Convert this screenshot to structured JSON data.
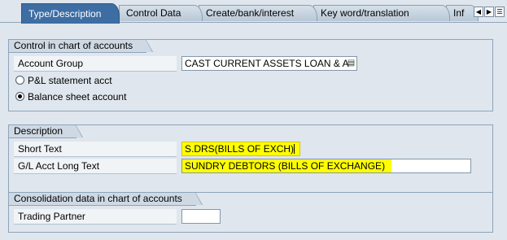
{
  "tabs": [
    {
      "label": "Type/Description",
      "active": true
    },
    {
      "label": "Control Data",
      "active": false
    },
    {
      "label": "Create/bank/interest",
      "active": false
    },
    {
      "label": "Key word/translation",
      "active": false
    },
    {
      "label": "Inf",
      "active": false
    }
  ],
  "tab_nav": {
    "prev_icon": "triangle-left",
    "next_icon": "triangle-right",
    "list_icon": "list"
  },
  "control_group": {
    "title": "Control in chart of accounts",
    "account_group_label": "Account Group",
    "account_group_value": "CAST CURRENT ASSETS LOAN & A",
    "pl_radio_label": "P&L statement acct",
    "bs_radio_label": "Balance sheet account",
    "selected_radio": "Balance sheet account"
  },
  "description_group": {
    "title": "Description",
    "short_text_label": "Short Text",
    "short_text_value": "S.DRS(BILLS OF EXCH)",
    "long_text_label": "G/L Acct Long Text",
    "long_text_value": "SUNDRY DEBTORS (BILLS OF EXCHANGE)"
  },
  "consolidation_group": {
    "title": "Consolidation data in chart of accounts",
    "trading_partner_label": "Trading Partner",
    "trading_partner_value": ""
  },
  "colors": {
    "active_tab": "#3d6da3",
    "highlight": "#ffff00",
    "background": "#dfe6ed"
  }
}
